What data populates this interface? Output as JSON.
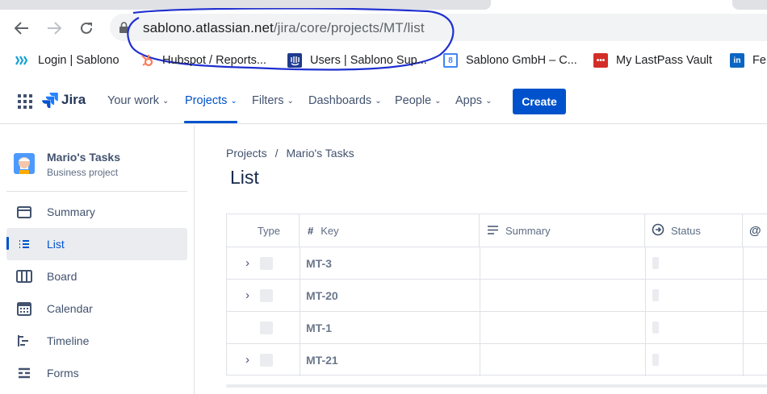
{
  "browser": {
    "url_host": "sablono.atlassian.net",
    "url_path": "/jira/core/projects/MT/list"
  },
  "bookmarks": [
    {
      "label": "Login | Sablono",
      "icon": "sablono-icon"
    },
    {
      "label": "Hubspot / Reports...",
      "icon": "hubspot-icon"
    },
    {
      "label": "Users | Sablono Sup...",
      "icon": "intercom-icon"
    },
    {
      "label": "Sablono GmbH – C...",
      "icon": "calendar-icon"
    },
    {
      "label": "My LastPass Vault",
      "icon": "lastpass-icon"
    },
    {
      "label": "Fe",
      "icon": "linkedin-icon"
    }
  ],
  "header": {
    "logo": "Jira",
    "nav": [
      {
        "label": "Your work"
      },
      {
        "label": "Projects"
      },
      {
        "label": "Filters"
      },
      {
        "label": "Dashboards"
      },
      {
        "label": "People"
      },
      {
        "label": "Apps"
      }
    ],
    "create_label": "Create",
    "accent": "#0052cc"
  },
  "sidebar": {
    "project_name": "Mario's Tasks",
    "project_type": "Business project",
    "items": [
      {
        "label": "Summary",
        "icon": "summary-icon"
      },
      {
        "label": "List",
        "icon": "list-icon"
      },
      {
        "label": "Board",
        "icon": "board-icon"
      },
      {
        "label": "Calendar",
        "icon": "calendar-icon"
      },
      {
        "label": "Timeline",
        "icon": "timeline-icon"
      },
      {
        "label": "Forms",
        "icon": "forms-icon"
      }
    ]
  },
  "main": {
    "breadcrumb": [
      "Projects",
      "/",
      "Mario's Tasks"
    ],
    "title": "List",
    "columns": [
      "Type",
      "Key",
      "Summary",
      "Status",
      "@"
    ],
    "rows": [
      {
        "key": "MT-3",
        "expandable": true
      },
      {
        "key": "MT-20",
        "expandable": true
      },
      {
        "key": "MT-1",
        "expandable": false
      },
      {
        "key": "MT-21",
        "expandable": true
      }
    ]
  }
}
